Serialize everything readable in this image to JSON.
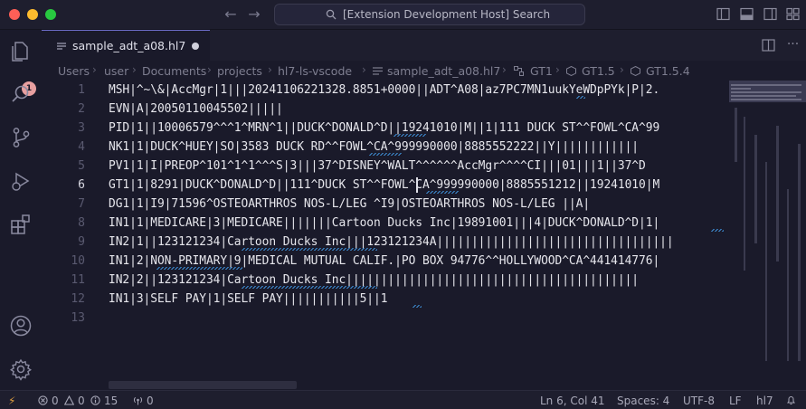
{
  "window": {
    "search_text": "[Extension Development Host] Search"
  },
  "activity": {
    "explorer_badge": "1"
  },
  "tab": {
    "label": "sample_adt_a08.hl7"
  },
  "breadcrumbs": {
    "items": [
      "Users",
      "user",
      "Documents",
      "projects",
      "hl7-ls-vscode",
      "sample_adt_a08.hl7",
      "GT1",
      "GT1.5",
      "GT1.5.4"
    ]
  },
  "editor": {
    "active_line": 6,
    "lines": [
      {
        "n": "1",
        "text": "MSH|^~\\&|AccMgr|1|||20241106221328.8851+0000||ADT^A08|az7PC7MN1uukYeWDpPYk|P|2."
      },
      {
        "n": "2",
        "text": "EVN|A|20050110045502|||||"
      },
      {
        "n": "3",
        "text": "PID|1||10006579^^^1^MRN^1||DUCK^DONALD^D||19241010|M||1|111 DUCK ST^^FOWL^CA^99"
      },
      {
        "n": "4",
        "text": "NK1|1|DUCK^HUEY|SO|3583 DUCK RD^^FOWL^CA^999990000|8885552222||Y||||||||||||"
      },
      {
        "n": "5",
        "text": "PV1|1|I|PREOP^101^1^1^^^S|3|||37^DISNEY^WALT^^^^^^AccMgr^^^^CI|||01|||1||37^D"
      },
      {
        "n": "6",
        "text": "GT1|1|8291|DUCK^DONALD^D||111^DUCK ST^^FOWL^CA^999990000|8885551212||19241010|M"
      },
      {
        "n": "7",
        "text": "DG1|1|I9|71596^OSTEOARTHROS NOS-L/LEG ^I9|OSTEOARTHROS NOS-L/LEG ||A|"
      },
      {
        "n": "8",
        "text": "IN1|1|MEDICARE|3|MEDICARE|||||||Cartoon Ducks Inc|19891001|||4|DUCK^DONALD^D|1|"
      },
      {
        "n": "9",
        "text": "IN2|1||123121234|Cartoon Ducks Inc|||123121234A||||||||||||||||||||||||||||||||||"
      },
      {
        "n": "10",
        "text": "IN1|2|NON-PRIMARY|9|MEDICAL MUTUAL CALIF.|PO BOX 94776^^HOLLYWOOD^CA^441414776|"
      },
      {
        "n": "11",
        "text": "IN2|2||123121234|Cartoon Ducks Inc||||||||||||||||||||||||||||||||||||||||||"
      },
      {
        "n": "12",
        "text": "IN1|3|SELF PAY|1|SELF PAY|||||||||||5||1"
      },
      {
        "n": "13",
        "text": ""
      }
    ]
  },
  "status": {
    "errors": "0",
    "warnings": "0",
    "infos": "15",
    "ports": "0",
    "position": "Ln 6, Col 41",
    "spaces": "Spaces: 4",
    "encoding": "UTF-8",
    "eol": "LF",
    "language": "hl7"
  },
  "colors": {
    "background": "#1a1a2a",
    "accent": "#6c6cc8",
    "close": "#ff5f57",
    "minimize": "#febc2e",
    "maximize": "#28c840",
    "squiggle": "#3c8ad0"
  }
}
